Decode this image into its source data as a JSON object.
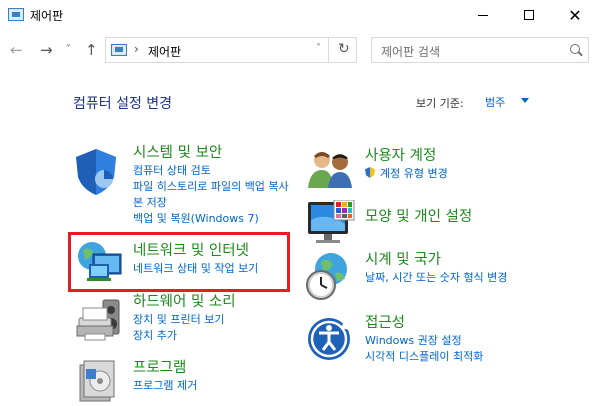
{
  "window": {
    "title": "제어판",
    "minimize_glyph": "",
    "close_glyph": "✕"
  },
  "nav": {
    "back_glyph": "←",
    "forward_glyph": "→",
    "recent_glyph": "˅",
    "up_glyph": "↑",
    "address_separator": "›",
    "address_text": "제어판",
    "address_dropdown_glyph": "˅",
    "refresh_glyph": "↻",
    "search_placeholder": "제어판 검색"
  },
  "header": {
    "title": "컴퓨터 설정 변경",
    "view_by_label": "보기 기준:",
    "view_by_value": "범주"
  },
  "categories": [
    {
      "title": "시스템 및 보안",
      "icon": "shield-icon",
      "links": [
        "컴퓨터 상태 검토",
        "파일 히스토리로 파일의 백업 복사본 저장",
        "백업 및 복원(Windows 7)"
      ]
    },
    {
      "title": "네트워크 및 인터넷",
      "icon": "network-globe-icon",
      "links": [
        "네트워크 상태 및 작업 보기"
      ]
    },
    {
      "title": "하드웨어 및 소리",
      "icon": "printer-speaker-icon",
      "links": [
        "장치 및 프린터 보기",
        "장치 추가"
      ]
    },
    {
      "title": "프로그램",
      "icon": "program-box-icon",
      "links": [
        "프로그램 제거"
      ]
    },
    {
      "title": "사용자 계정",
      "icon": "users-icon",
      "links": [
        "계정 유형 변경"
      ]
    },
    {
      "title": "모양 및 개인 설정",
      "icon": "monitor-palette-icon",
      "links": []
    },
    {
      "title": "시계 및 국가",
      "icon": "clock-globe-icon",
      "links": [
        "날짜, 시간 또는 숫자 형식 변경"
      ]
    },
    {
      "title": "접근성",
      "icon": "accessibility-icon",
      "links": [
        "Windows 권장 설정",
        "시각적 디스플레이 최적화"
      ]
    }
  ],
  "colors": {
    "category_title": "#1d8a1d",
    "link": "#0066cc",
    "heading": "#1e3287",
    "highlight_box": "#e21d24"
  }
}
